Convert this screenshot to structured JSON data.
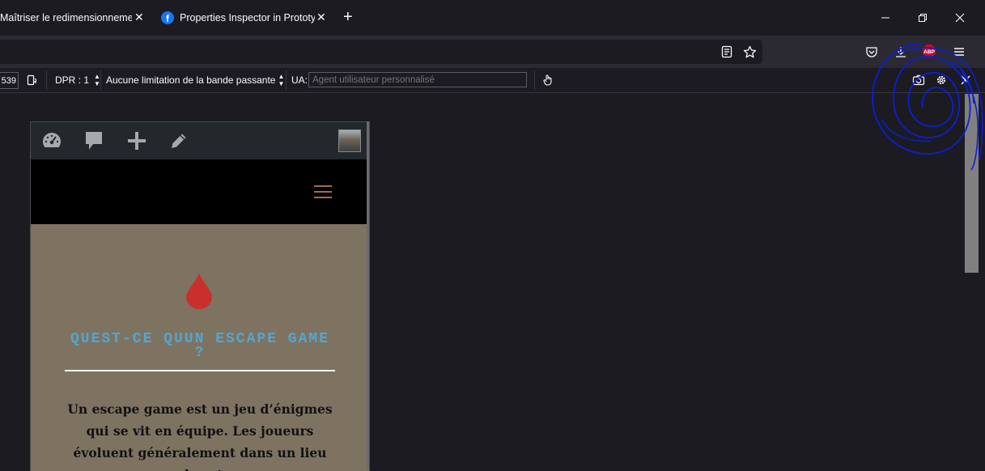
{
  "tabs": [
    {
      "title": "Maîtriser le redimensionnement",
      "active": false
    },
    {
      "title": "Properties Inspector in Prototyp",
      "active": true,
      "favicon": "facebook-icon"
    }
  ],
  "toolbar": {
    "icons": [
      "reader-view-icon",
      "bookmark-star-icon",
      "pocket-icon",
      "downloads-icon",
      "adblock-plus-icon",
      "menu-icon"
    ],
    "abp_badge": "ABP"
  },
  "rdm": {
    "width_value": "539",
    "dpr_label": "DPR : 1",
    "throttle_label": "Aucune limitation de la bande passante",
    "ua_label": "UA:",
    "ua_placeholder": "Agent utilisateur personnalisé"
  },
  "site": {
    "headline": "QUEST-CE QUUN ESCAPE GAME ?",
    "paragraph": "Un escape game est un jeu d’énigmes qui se vit en équipe. Les joueurs évoluent généralement dans un lieu clos et"
  },
  "colors": {
    "site_background": "#7e7361",
    "headline": "#52a6d4",
    "drop": "#c9302c",
    "scribble": "#0a1fd6"
  }
}
